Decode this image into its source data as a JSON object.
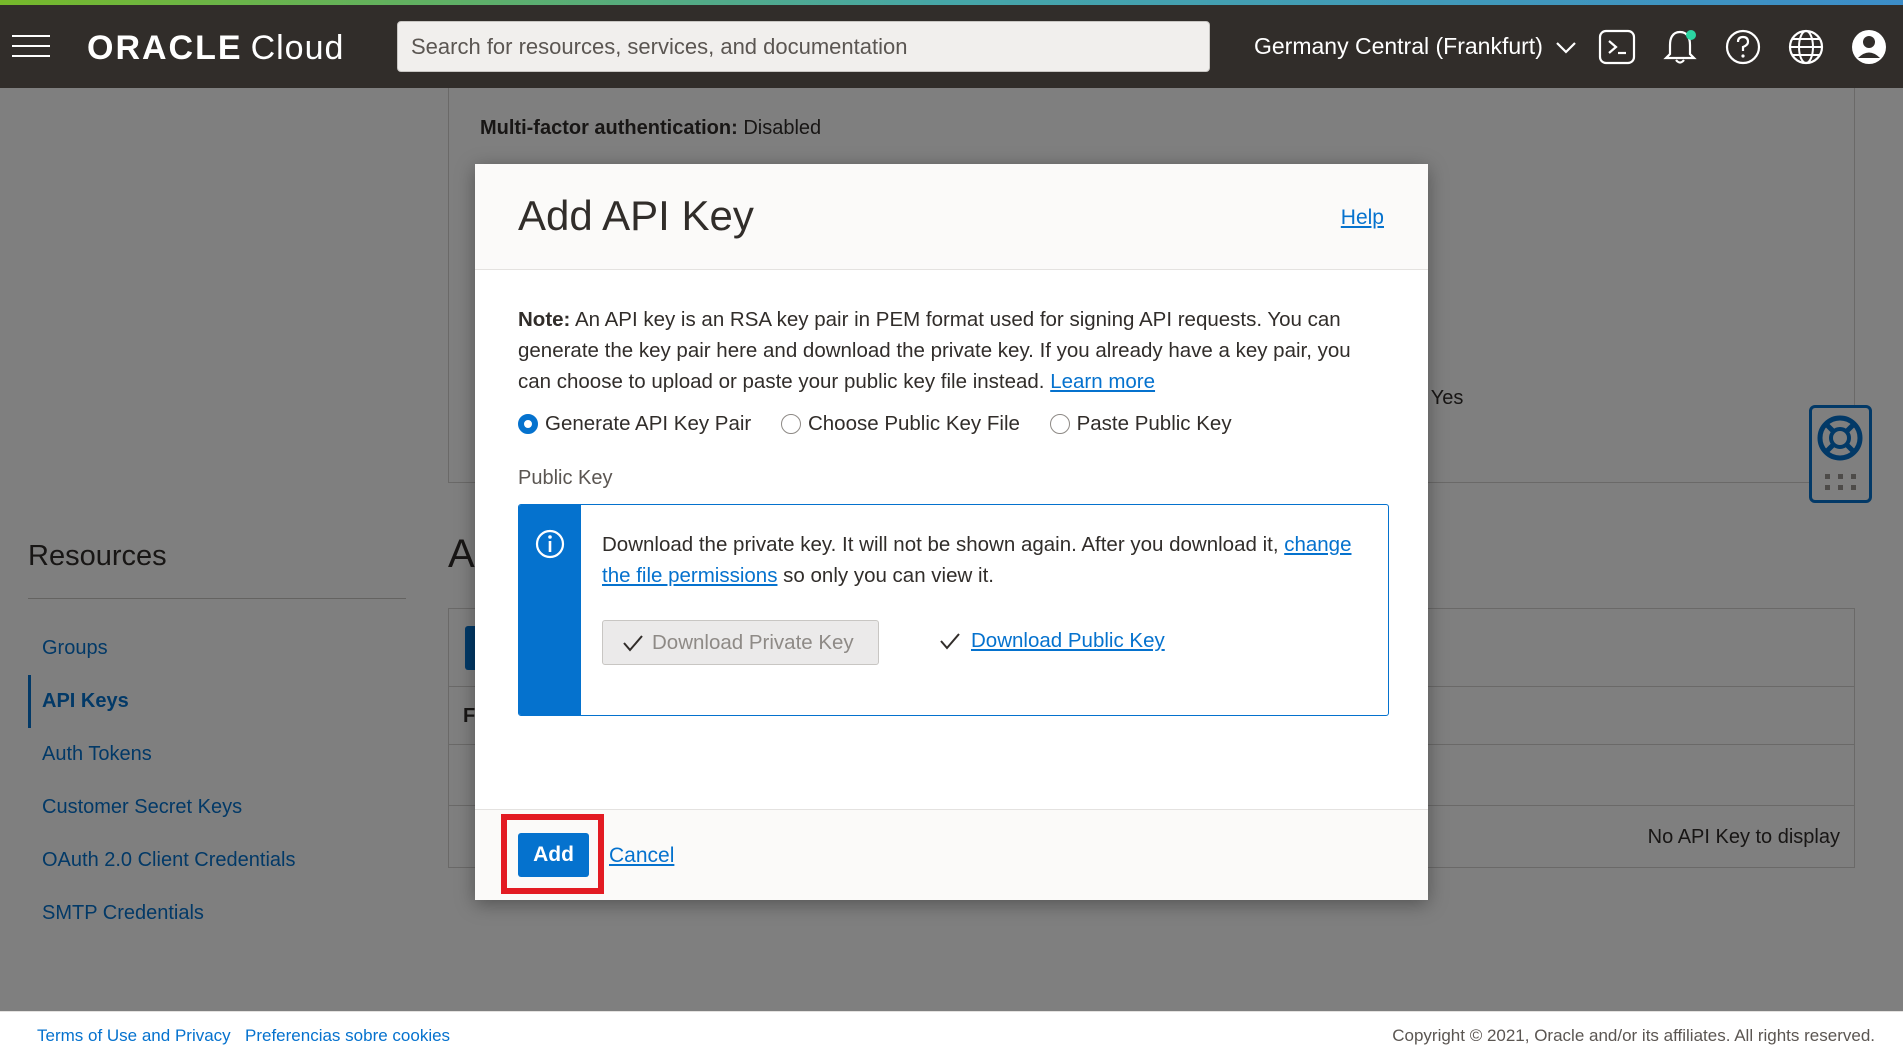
{
  "nav": {
    "brand_main": "ORACLE",
    "brand_sub": "Cloud",
    "search_placeholder": "Search for resources, services, and documentation",
    "region": "Germany Central (Frankfurt)"
  },
  "background": {
    "mfa_label": "Multi-factor authentication:",
    "mfa_value": "Disabled",
    "partial_field": "s: Yes",
    "section_heading_partial": "A",
    "table_partial_header": "F",
    "empty_message": "No API Key to display",
    "resources_title": "Resources",
    "resources": [
      {
        "label": "Groups"
      },
      {
        "label": "API Keys"
      },
      {
        "label": "Auth Tokens"
      },
      {
        "label": "Customer Secret Keys"
      },
      {
        "label": "OAuth 2.0 Client Credentials"
      },
      {
        "label": "SMTP Credentials"
      }
    ]
  },
  "modal": {
    "title": "Add API Key",
    "help": "Help",
    "note_label": "Note:",
    "note_text": " An API key is an RSA key pair in PEM format used for signing API requests. You can generate the key pair here and download the private key. If you already have a key pair, you can choose to upload or paste your public key file instead. ",
    "note_link": "Learn more",
    "options": [
      {
        "label": "Generate API Key Pair",
        "selected": true
      },
      {
        "label": "Choose Public Key File",
        "selected": false
      },
      {
        "label": "Paste Public Key",
        "selected": false
      }
    ],
    "public_key_label": "Public Key",
    "info_text_1": "Download the private key. It will not be shown again. After you download it, ",
    "info_link": "change the file permissions",
    "info_text_2": " so only you can view it.",
    "download_private": "Download Private Key",
    "download_public": "Download Public Key",
    "add_button": "Add",
    "cancel": "Cancel"
  },
  "footer": {
    "terms": "Terms of Use and Privacy",
    "cookies": "Preferencias sobre cookies",
    "copyright": "Copyright © 2021, Oracle and/or its affiliates. All rights reserved."
  },
  "colors": {
    "nav_bg": "#312d2a",
    "accent": "#0572ce",
    "highlight": "#e31b23"
  }
}
